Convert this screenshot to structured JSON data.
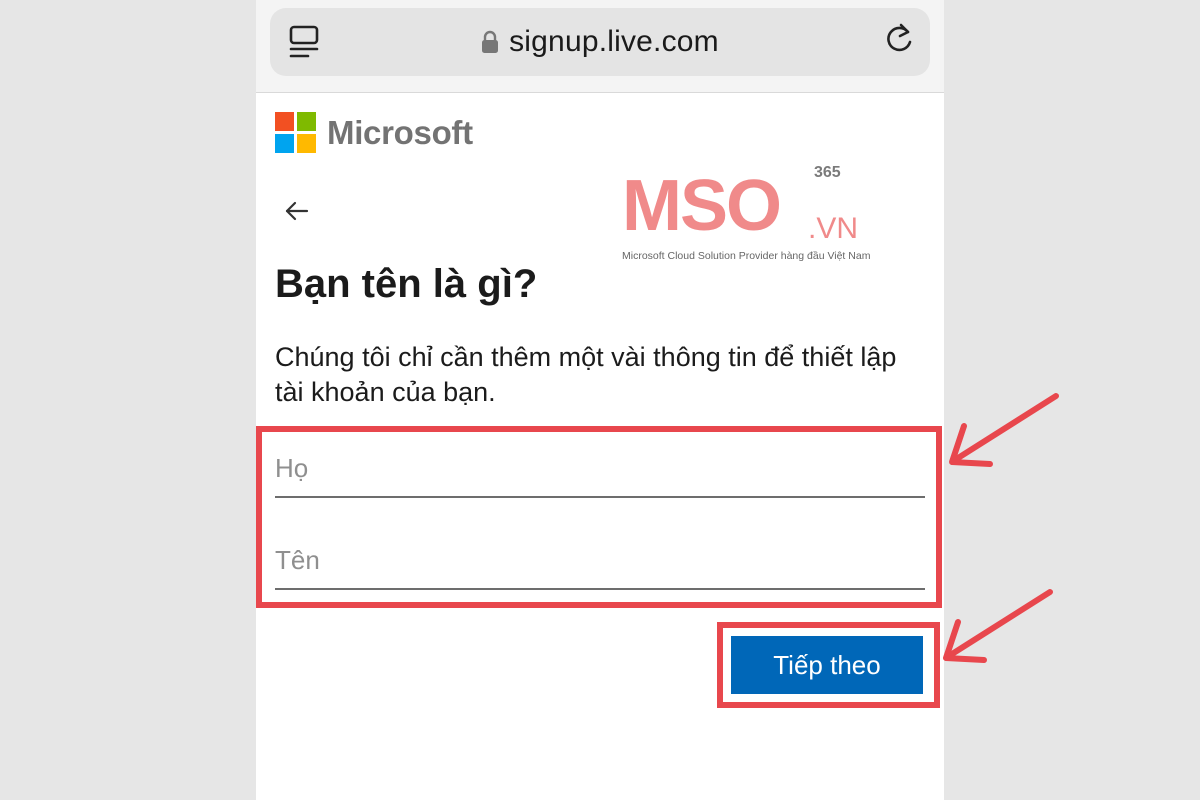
{
  "browser": {
    "url": "signup.live.com",
    "icons": [
      "reader-mode-icon",
      "lock-icon",
      "reload-icon"
    ]
  },
  "brand": {
    "name": "Microsoft",
    "colors": {
      "red": "#f25022",
      "green": "#7fba00",
      "blue": "#00a4ef",
      "yellow": "#ffb900"
    }
  },
  "watermark": {
    "superscript": "365",
    "wordmark": "MSO",
    "domain": ".VN",
    "tagline": "Microsoft Cloud Solution Provider hàng đầu Việt Nam"
  },
  "page": {
    "title": "Bạn tên là gì?",
    "description": "Chúng tôi chỉ cần thêm một vài thông tin để thiết lập tài khoản của bạn."
  },
  "form": {
    "last_name_placeholder": "Họ",
    "last_name_value": "",
    "first_name_placeholder": "Tên",
    "first_name_value": "",
    "next_label": "Tiếp theo"
  },
  "colors": {
    "accent": "#0067b8",
    "highlight": "#e8474d",
    "watermark": "#f08a8a"
  }
}
